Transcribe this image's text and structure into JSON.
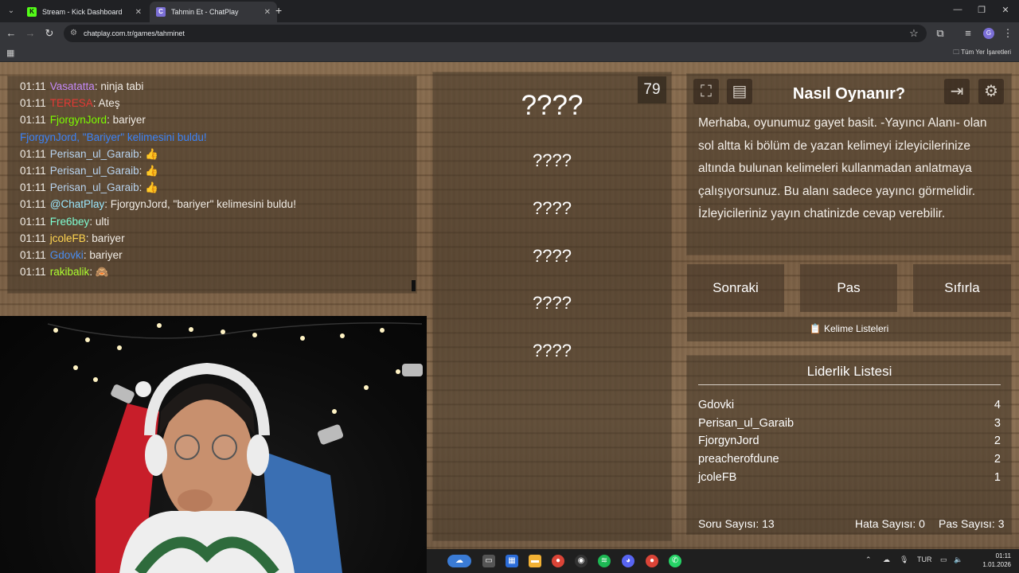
{
  "browser": {
    "tabs": [
      {
        "title": "Stream - Kick Dashboard",
        "favicon": "kick-icon",
        "favicon_color": "#53fc18",
        "active": false
      },
      {
        "title": "Tahmin Et - ChatPlay",
        "favicon": "chatplay-icon",
        "favicon_color": "#7b6fd6",
        "active": true
      }
    ],
    "url": "chatplay.com.tr/games/tahminet",
    "avatar_letter": "G",
    "bookmarks_label": "Tüm Yer İşaretleri"
  },
  "chat": {
    "messages": [
      {
        "time": "01:11",
        "user": "Vasatatta",
        "user_color": "#c58af9",
        "text": ": ninja tabi"
      },
      {
        "time": "01:11",
        "user": "TERESA",
        "user_color": "#e53935",
        "text": ": Ateş"
      },
      {
        "time": "01:11",
        "user": "FjorgynJord",
        "user_color": "#7cfc00",
        "text": ": bariyer"
      },
      {
        "time": "",
        "user": "FjorgynJord, \"Bariyer\" kelimesini buldu!",
        "user_color": "#3b82f6",
        "text": ""
      },
      {
        "time": "01:11",
        "user": "Perisan_ul_Garaib",
        "user_color": "#b8d4f0",
        "text": ": 👍"
      },
      {
        "time": "01:11",
        "user": "Perisan_ul_Garaib",
        "user_color": "#b8d4f0",
        "text": ": 👍"
      },
      {
        "time": "01:11",
        "user": "Perisan_ul_Garaib",
        "user_color": "#b8d4f0",
        "text": ": 👍"
      },
      {
        "time": "01:11",
        "user": "@ChatPlay",
        "user_color": "#9be9ff",
        "text": ": FjorgynJord, \"bariyer\" kelimesini buldu!"
      },
      {
        "time": "01:11",
        "user": "Fre6bey",
        "user_color": "#7fffd4",
        "text": ": ulti"
      },
      {
        "time": "01:11",
        "user": "jcoleFB",
        "user_color": "#ffd54f",
        "text": ": bariyer"
      },
      {
        "time": "01:11",
        "user": "Gdovki",
        "user_color": "#4a8df0",
        "text": ": bariyer"
      },
      {
        "time": "01:11",
        "user": "rakibalik",
        "user_color": "#adff2f",
        "text": ": 🙈"
      }
    ]
  },
  "game": {
    "counter": "79",
    "words": [
      "????",
      "????",
      "????",
      "????",
      "????",
      "????"
    ],
    "howto_title": "Nasıl Oynanır?",
    "howto_body": "Merhaba, oyunumuz gayet basit. -Yayıncı Alanı- olan sol altta ki bölüm de yazan kelimeyi izleyicilerinize altında bulunan kelimeleri kullanmadan anlatmaya çalışıyorsunuz. Bu alanı sadece yayıncı görmelidir. İzleyicileriniz yayın chatinizde cevap verebilir.",
    "buttons": {
      "next": "Sonraki",
      "pass": "Pas",
      "reset": "Sıfırla"
    },
    "word_lists": "📋 Kelime Listeleri",
    "leaderboard_title": "Liderlik Listesi",
    "leaderboard": [
      {
        "name": "Gdovki",
        "score": "4"
      },
      {
        "name": "Perisan_ul_Garaib",
        "score": "3"
      },
      {
        "name": "FjorgynJord",
        "score": "2"
      },
      {
        "name": "preacherofdune",
        "score": "2"
      },
      {
        "name": "jcoleFB",
        "score": "1"
      }
    ],
    "stats": {
      "questions": "Soru Sayısı: 13",
      "errors": "Hata Sayısı: 0",
      "passes": "Pas Sayısı: 3"
    }
  },
  "taskbar": {
    "language": "TUR",
    "time": "01:11",
    "date": "1.01.2026"
  }
}
